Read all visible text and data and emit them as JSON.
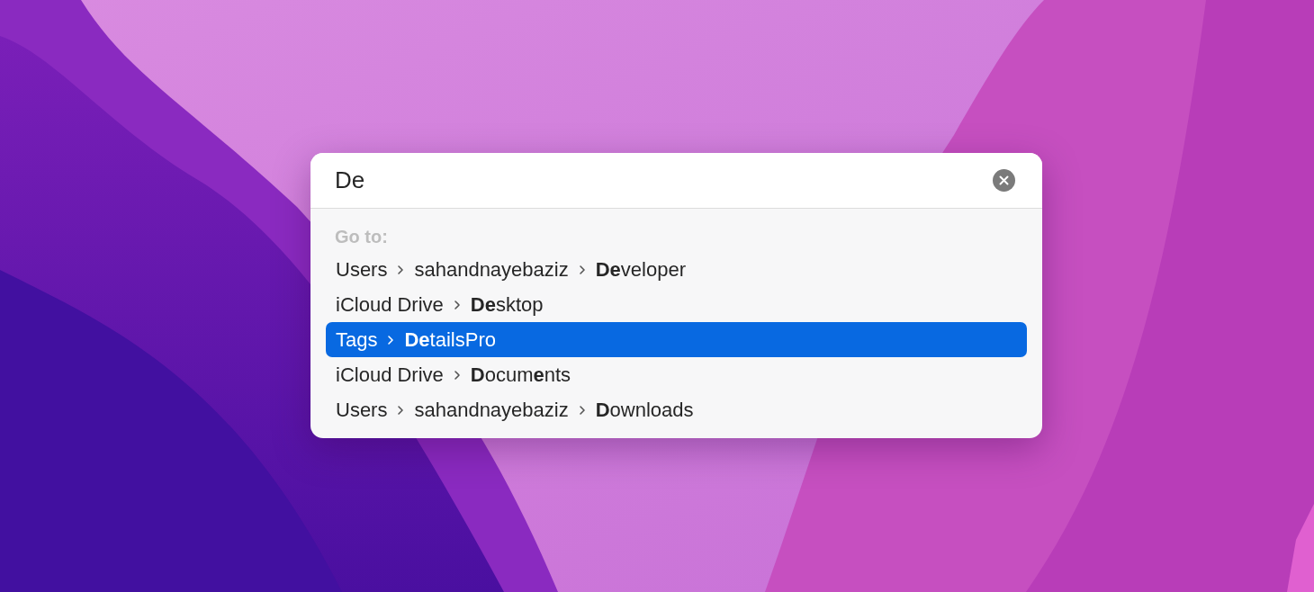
{
  "search": {
    "value": "De"
  },
  "section_label": "Go to:",
  "results": [
    {
      "path": [
        "Users",
        "sahandnayebaziz",
        "**De**veloper"
      ],
      "selected": false
    },
    {
      "path": [
        "iCloud Drive",
        "**De**sktop"
      ],
      "selected": false
    },
    {
      "path": [
        "Tags",
        "**De**tailsPro"
      ],
      "selected": true
    },
    {
      "path": [
        "iCloud Drive",
        "**D**ocum**e**nts"
      ],
      "selected": false
    },
    {
      "path": [
        "Users",
        "sahandnayebaziz",
        "**D**ownloads"
      ],
      "selected": false
    }
  ]
}
